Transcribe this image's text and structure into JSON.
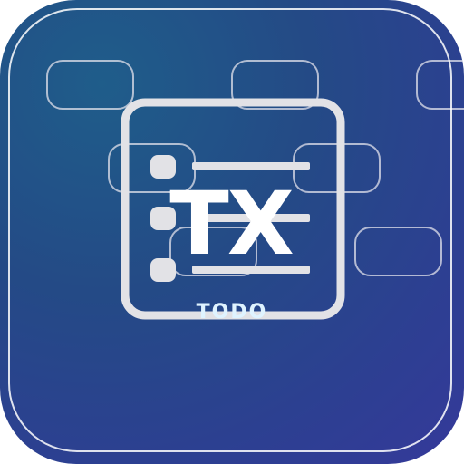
{
  "icon": {
    "monogram": "TX",
    "label": "TODO",
    "glyph": "checklist-icon"
  },
  "colors": {
    "background_start": "#1f5d8a",
    "background_end": "#35399a",
    "outline": "#e6e6ea",
    "text": "#ffffff",
    "label": "#dff3ff"
  }
}
